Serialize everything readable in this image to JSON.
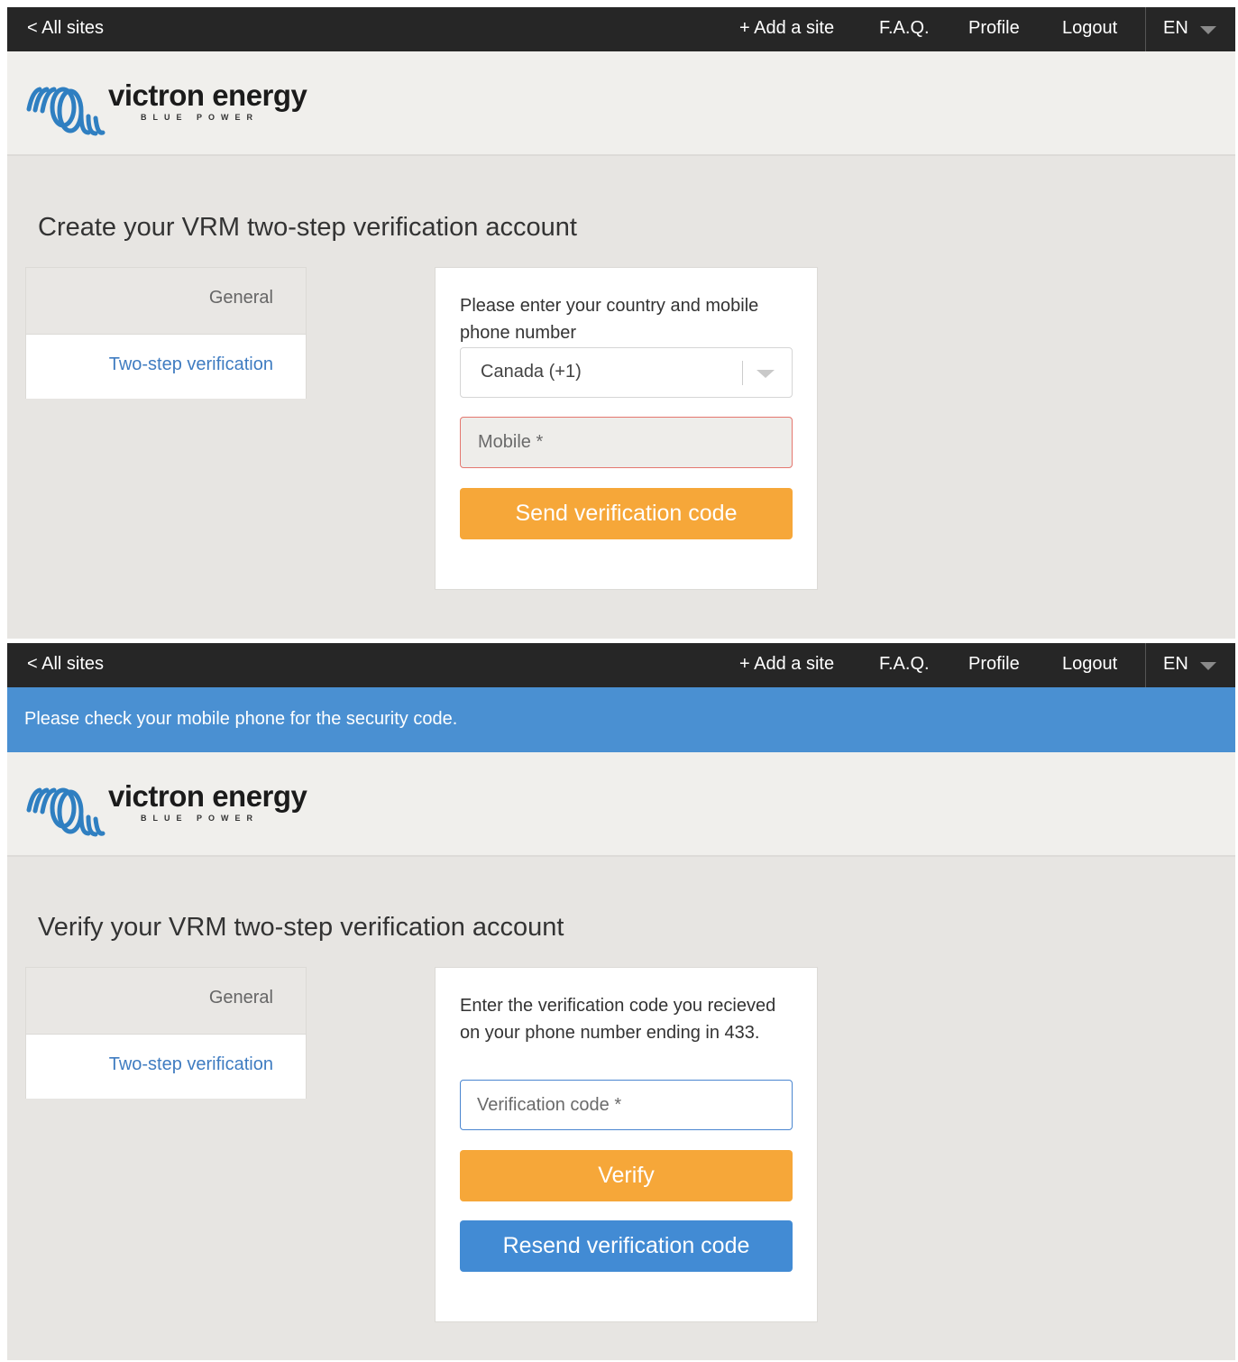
{
  "nav": {
    "all_sites": "< All sites",
    "add_site": "+ Add a site",
    "faq": "F.A.Q.",
    "profile": "Profile",
    "logout": "Logout",
    "language": "EN"
  },
  "logo": {
    "name": "victron energy",
    "tagline": "BLUE POWER",
    "graphic_icon": "victron-wave-logo",
    "brand_color": "#2f7fc1"
  },
  "menu": {
    "general": "General",
    "two_step": "Two-step verification"
  },
  "create_screen": {
    "title": "Create your VRM two-step verification account",
    "instruction": "Please enter your country and mobile phone number",
    "country_selected": "Canada (+1)",
    "mobile_placeholder": "Mobile *",
    "send_button": "Send verification code"
  },
  "verify_screen": {
    "flash_message": "Please check your mobile phone for the security code.",
    "title": "Verify your VRM two-step verification account",
    "instruction": "Enter the verification code you recieved on your phone number ending in 433.",
    "code_placeholder": "Verification code *",
    "verify_button": "Verify",
    "resend_button": "Resend verification code"
  },
  "colors": {
    "topbar": "#262626",
    "flash": "#4a90d2",
    "primary_button": "#f6a739",
    "secondary_button": "#428bd4",
    "link": "#3f7cc1",
    "error_border": "#e4776f"
  }
}
